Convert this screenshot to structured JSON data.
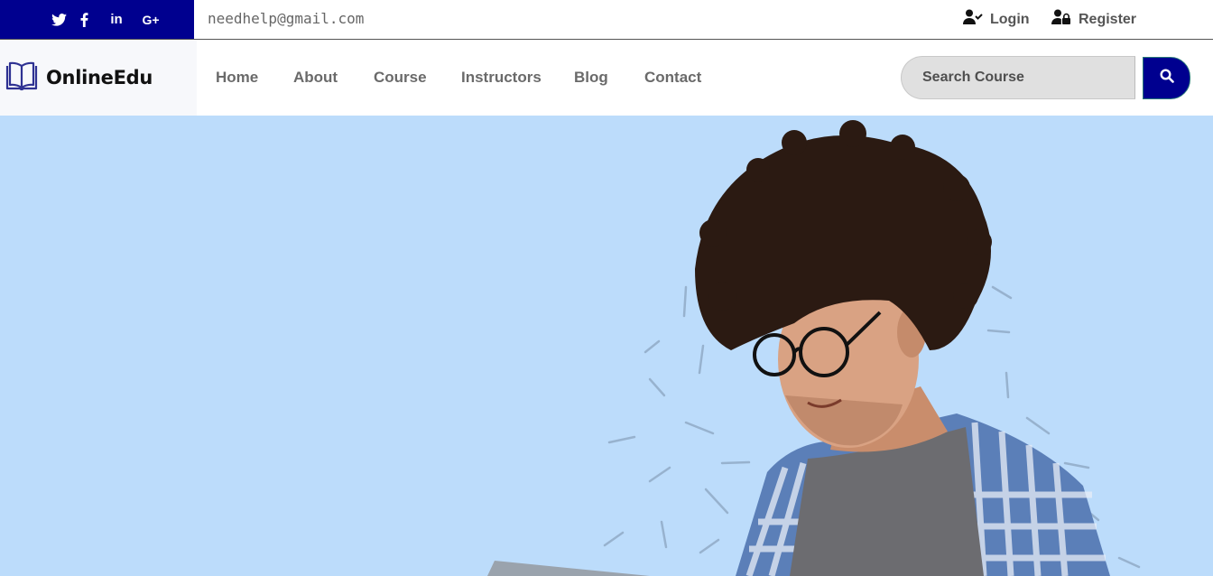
{
  "topbar": {
    "social_icons": [
      "twitter-icon",
      "facebook-icon",
      "linkedin-icon",
      "google-plus-icon"
    ],
    "social_labels": {
      "linkedin": "in",
      "google": "G+"
    },
    "email": "needhelp@gmail.com",
    "login_label": "Login",
    "register_label": "Register"
  },
  "brand": {
    "name": "OnlineEdu",
    "icon": "open-book-icon"
  },
  "nav": {
    "items": [
      "Home",
      "About",
      "Course",
      "Instructors",
      "Blog",
      "Contact"
    ]
  },
  "search": {
    "placeholder": "Search Course",
    "button_icon": "search-icon"
  },
  "colors": {
    "primary": "#00008f",
    "hero_bg": "#bcdcfb",
    "nav_text": "#6a6a6a",
    "search_bg": "#e0e0e0"
  }
}
